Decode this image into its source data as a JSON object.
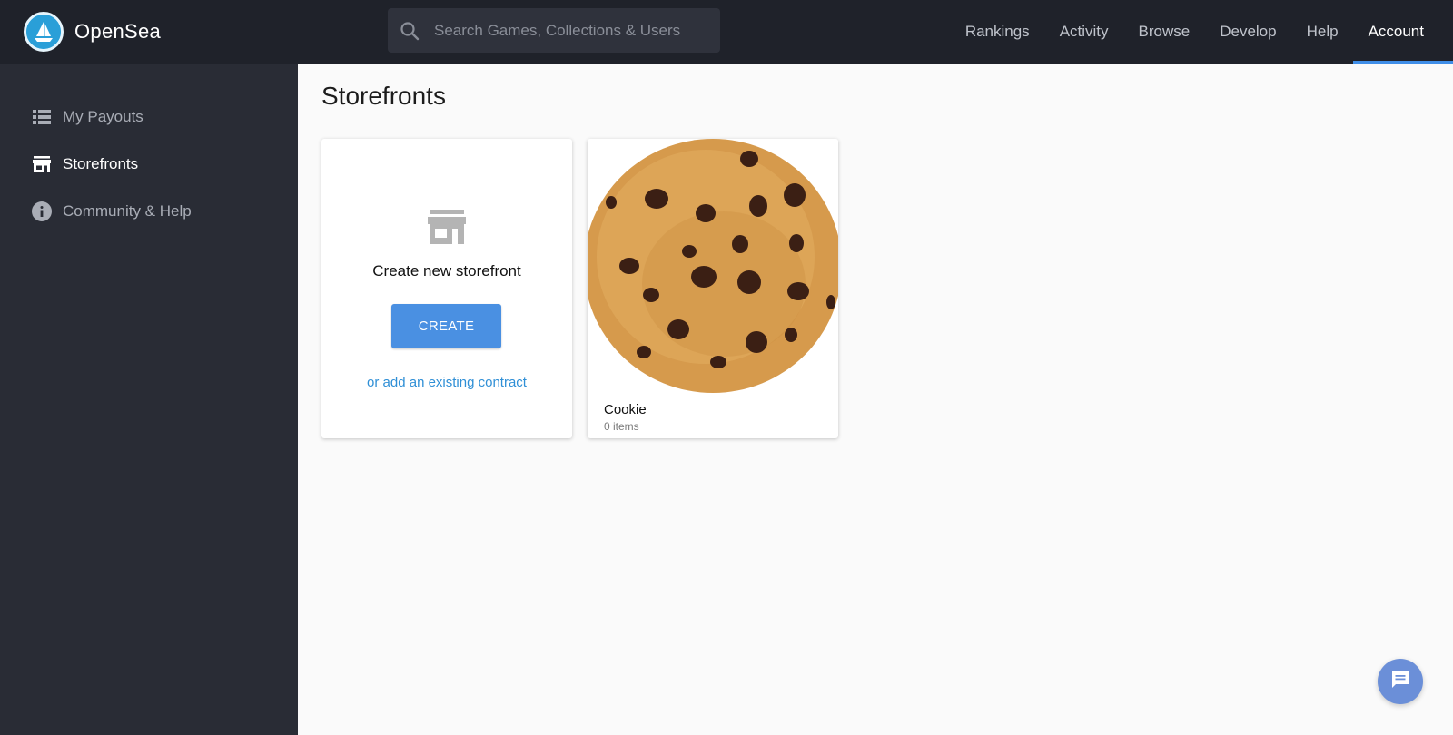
{
  "app": {
    "name": "OpenSea"
  },
  "search": {
    "placeholder": "Search Games, Collections & Users",
    "icon": "search-icon"
  },
  "nav": {
    "items": [
      {
        "label": "Rankings"
      },
      {
        "label": "Activity"
      },
      {
        "label": "Browse"
      },
      {
        "label": "Develop"
      },
      {
        "label": "Help"
      },
      {
        "label": "Account",
        "active": true
      }
    ]
  },
  "sidebar": {
    "items": [
      {
        "label": "My Payouts",
        "icon": "list-icon"
      },
      {
        "label": "Storefronts",
        "icon": "storefront-icon",
        "active": true
      },
      {
        "label": "Community & Help",
        "icon": "info-icon"
      }
    ]
  },
  "main": {
    "title": "Storefronts",
    "create_card": {
      "title": "Create new storefront",
      "button_label": "CREATE",
      "link_text": "or add an existing contract"
    },
    "storefronts": [
      {
        "name": "Cookie",
        "count": "0 items"
      }
    ]
  },
  "colors": {
    "topbar": "#1f222a",
    "sidebar": "#292c35",
    "accent": "#4a90e2",
    "link": "#2f8fd6",
    "chat": "#6b8fd8"
  }
}
